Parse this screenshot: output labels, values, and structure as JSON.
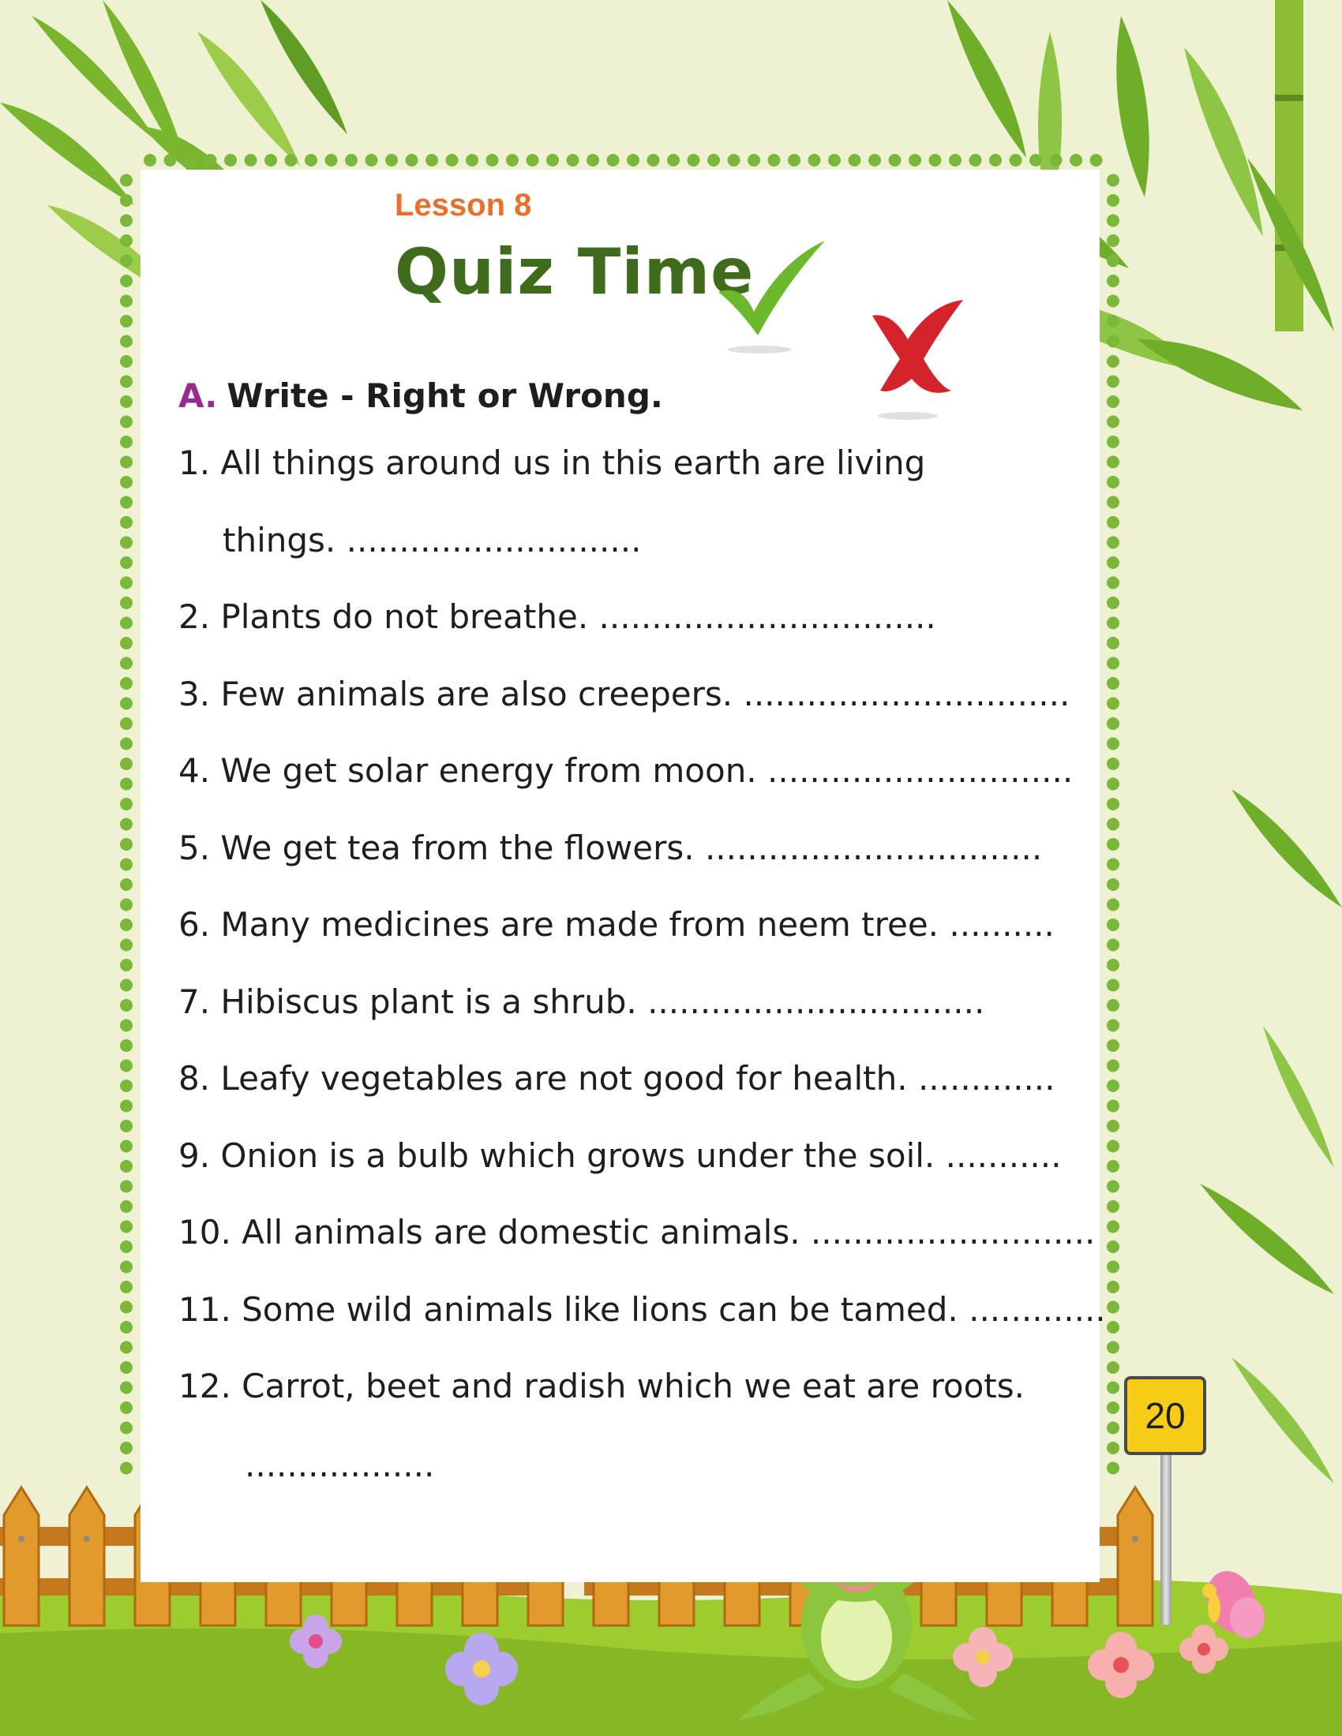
{
  "lesson": "Lesson 8",
  "title": "Quiz Time",
  "section": {
    "letter": "A.",
    "text": "Write - Right or Wrong."
  },
  "questions": [
    {
      "line1": "1. All things around us in this earth are living",
      "line2": "things. ............................"
    },
    {
      "line1": "2. Plants do not breathe. ................................"
    },
    {
      "line1": "3. Few animals are also creepers. ..............................."
    },
    {
      "line1": "4. We get solar energy from moon. ............................."
    },
    {
      "line1": "5. We get tea from the flowers. ................................"
    },
    {
      "line1": "6. Many medicines are made from neem tree. .........."
    },
    {
      "line1": "7. Hibiscus plant is a shrub. ................................"
    },
    {
      "line1": "8. Leafy vegetables are not good for health. ............."
    },
    {
      "line1": "9. Onion is a bulb which grows under the soil. ..........."
    },
    {
      "line1": "10. All animals are domestic animals. ..........................."
    },
    {
      "line1": "11. Some wild animals like lions can be tamed. ............."
    },
    {
      "line1": "12. Carrot, beet and radish which we eat are roots.",
      "line2": ".................."
    }
  ],
  "page_number": "20",
  "icons": [
    "green-check-icon",
    "red-cross-icon",
    "frog-illustration",
    "butterfly-illustration",
    "bamboo-leaves",
    "wooden-fence",
    "flowers"
  ],
  "colors": {
    "lesson": "#e8702a",
    "title": "#3f6b1c",
    "section_letter": "#9b2a8e",
    "dots": "#7bb83a",
    "background": "#eef1d2"
  }
}
